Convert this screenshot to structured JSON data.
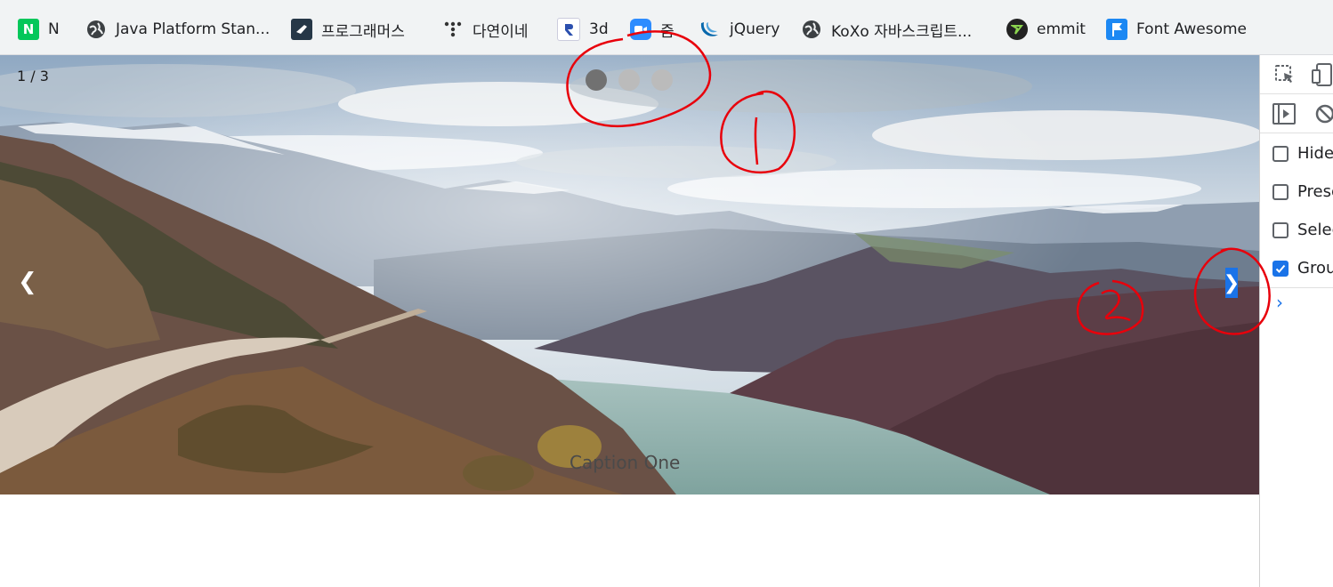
{
  "bookmarks": [
    {
      "label": "N",
      "icon": "naver-icon"
    },
    {
      "label": "Java Platform Stan...",
      "icon": "globe-icon"
    },
    {
      "label": "프로그래머스",
      "icon": "programmers-icon"
    },
    {
      "label": "다연이네",
      "icon": "dots-icon"
    },
    {
      "label": "3d",
      "icon": "3d-icon"
    },
    {
      "label": "줌",
      "icon": "zoom-icon"
    },
    {
      "label": "jQuery",
      "icon": "jquery-icon"
    },
    {
      "label": "KoXo 자바스크립트...",
      "icon": "globe-icon"
    },
    {
      "label": "emmit",
      "icon": "emmet-icon"
    },
    {
      "label": "Font Awesome",
      "icon": "flag-icon"
    }
  ],
  "slideshow": {
    "number_text": "1 / 3",
    "prev": "❮",
    "next": "❯",
    "caption": "Caption One",
    "dots": [
      {
        "active": true
      },
      {
        "active": false
      },
      {
        "active": false
      }
    ]
  },
  "devtools": {
    "checkboxes": [
      {
        "label": "Hide",
        "checked": false
      },
      {
        "label": "Prese",
        "checked": false
      },
      {
        "label": "Selec",
        "checked": false
      },
      {
        "label": "Grou",
        "checked": true
      }
    ],
    "chevron": "›"
  },
  "annotations": {
    "mark_1": "1",
    "mark_2": "2"
  },
  "colors": {
    "annotation": "#e8000b",
    "accent": "#1a73e8",
    "dot_active": "#717171",
    "dot_inactive": "#bbbbbb"
  }
}
